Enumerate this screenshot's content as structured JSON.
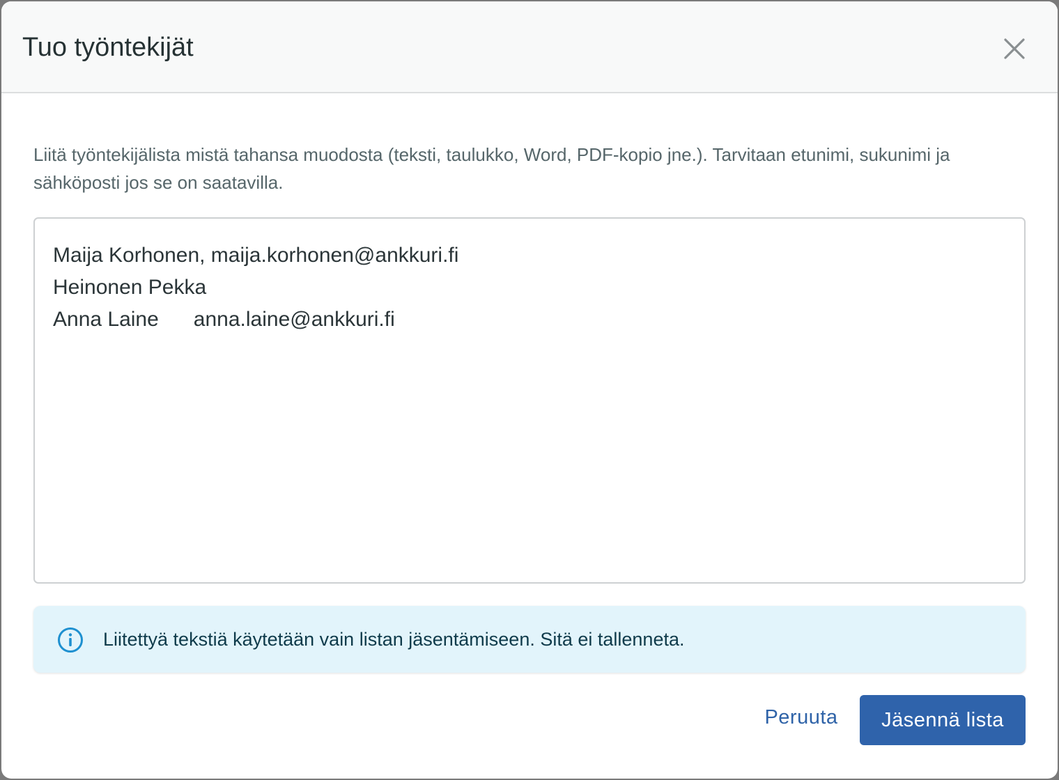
{
  "dialog": {
    "title": "Tuo työntekijät",
    "close_icon": "close-icon"
  },
  "body": {
    "description": "Liitä työntekijälista mistä tahansa muodosta (teksti, taulukko, Word, PDF-kopio jne.). Tarvitaan etunimi, sukunimi ja sähköposti jos se on saatavilla.",
    "pasted_lines": [
      "Maija Korhonen, maija.korhonen@ankkuri.fi",
      "Heinonen Pekka",
      "Anna Laine      anna.laine@ankkuri.fi"
    ],
    "info": {
      "icon": "info-icon",
      "text": "Liitettyä tekstiä käytetään vain listan jäsentämiseen. Sitä ei tallenneta."
    }
  },
  "footer": {
    "cancel_label": "Peruuta",
    "submit_label": "Jäsennä lista"
  },
  "colors": {
    "primary": "#2f63ab",
    "info_bg": "#e2f4fb",
    "info_icon": "#1e90d0"
  }
}
